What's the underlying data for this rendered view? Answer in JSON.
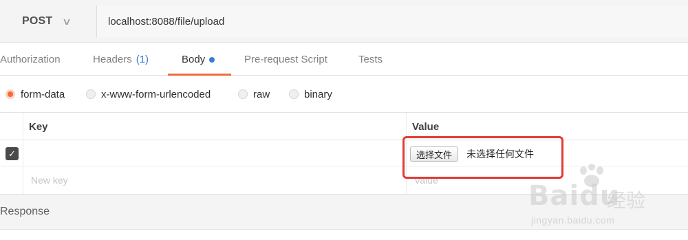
{
  "request": {
    "method": "POST",
    "url": "localhost:8088/file/upload"
  },
  "tabs": [
    {
      "label": "Authorization"
    },
    {
      "label": "Headers",
      "count": "(1)"
    },
    {
      "label": "Body"
    },
    {
      "label": "Pre-request Script"
    },
    {
      "label": "Tests"
    }
  ],
  "body_types": [
    {
      "label": "form-data",
      "checked": true
    },
    {
      "label": "x-www-form-urlencoded",
      "checked": false
    },
    {
      "label": "raw",
      "checked": false
    },
    {
      "label": "binary",
      "checked": false
    }
  ],
  "table": {
    "headers": {
      "key": "Key",
      "value": "Value"
    },
    "file_button": "选择文件",
    "file_status": "未选择任何文件",
    "new_key_placeholder": "New key",
    "new_value_placeholder": "Value"
  },
  "response": {
    "label": "Response"
  },
  "watermark": {
    "logo": "Baidu",
    "jingyan": "经验",
    "url": "jingyan.baidu.com"
  },
  "colors": {
    "accent": "#f26b3a",
    "count": "#3a7bd5",
    "highlight": "#e23a34"
  }
}
